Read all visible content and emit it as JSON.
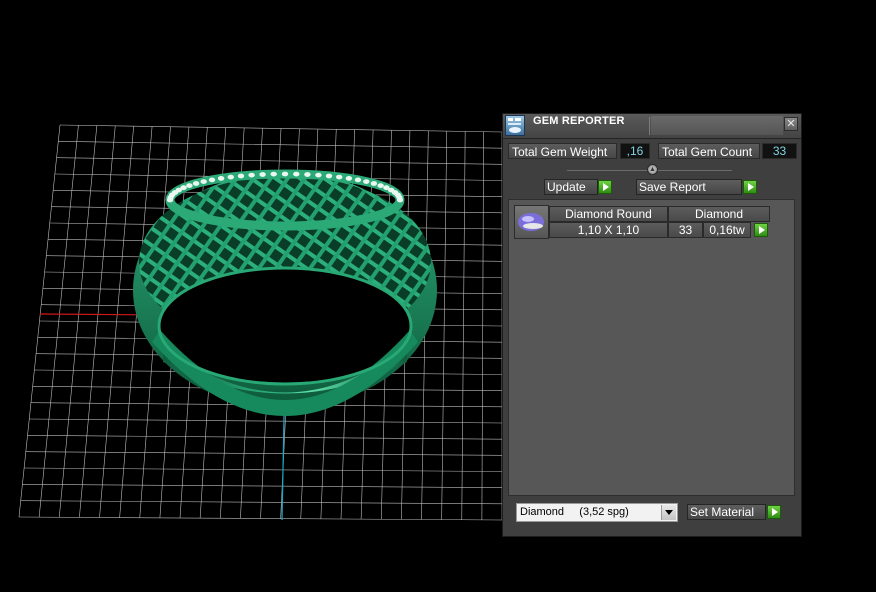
{
  "gem_reporter": {
    "title": "GEM REPORTER",
    "close_glyph": "✕",
    "total_gem_weight_label": "Total Gem Weight",
    "total_gem_weight_value": ",16",
    "total_gem_count_label": "Total Gem Count",
    "total_gem_count_value": "33",
    "update_label": "Update",
    "save_report_label": "Save Report",
    "gem_row": {
      "shape": "Diamond Round",
      "material": "Diamond",
      "size": "1,10 X 1,10",
      "count": "33",
      "weight": "0,16tw"
    },
    "material_select": "Diamond     (3,52 spg)",
    "set_material_label": "Set Material"
  },
  "colors": {
    "background": "#000000",
    "grid": "#bdbdbd",
    "ring": "#1f8c62",
    "accent_green": "#3fb11c",
    "axis_red": "#d01818",
    "axis_cyan": "#1aa8c8",
    "value_text": "#7fd4e0"
  },
  "icons": [
    "gem-reporter-icon",
    "close-icon",
    "slider-knob-icon",
    "play-arrow-icon",
    "dropdown-arrow-icon",
    "diamond-thumbnail-icon"
  ]
}
